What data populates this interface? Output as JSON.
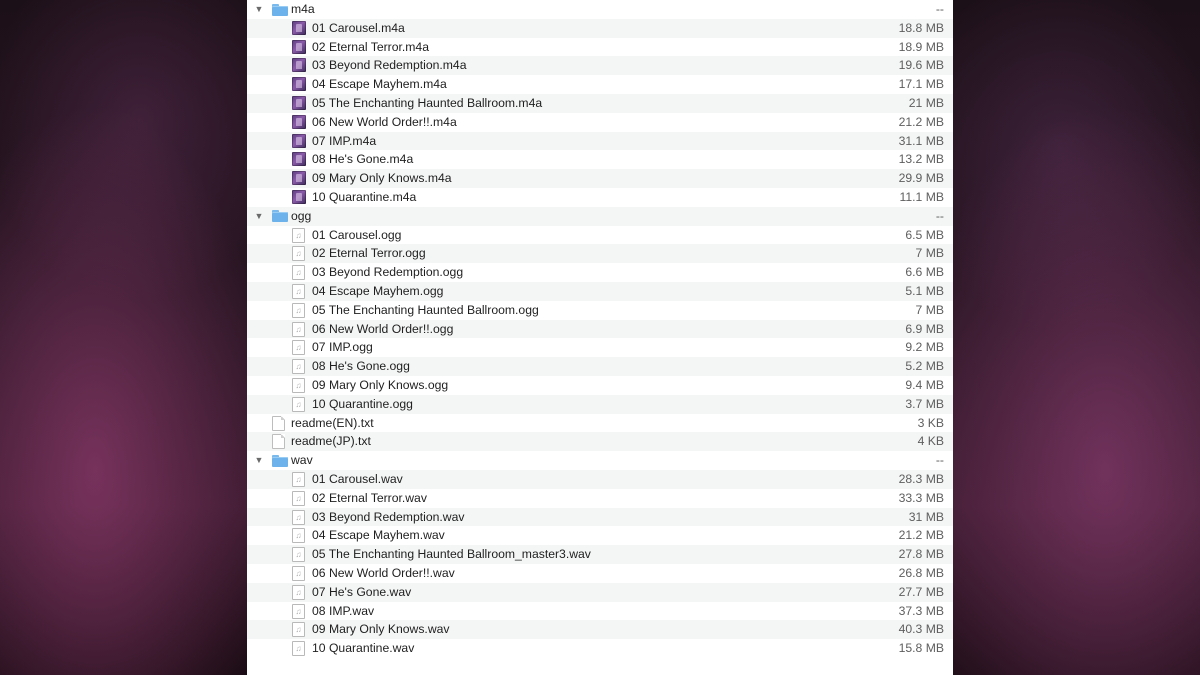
{
  "rows": [
    {
      "type": "folder",
      "name": "m4a",
      "size": "--",
      "expanded": true,
      "icon": "folder-icon"
    },
    {
      "type": "m4a",
      "name": "01 Carousel.m4a",
      "size": "18.8 MB",
      "icon": "album-art-icon"
    },
    {
      "type": "m4a",
      "name": "02 Eternal Terror.m4a",
      "size": "18.9 MB",
      "icon": "album-art-icon"
    },
    {
      "type": "m4a",
      "name": "03 Beyond Redemption.m4a",
      "size": "19.6 MB",
      "icon": "album-art-icon"
    },
    {
      "type": "m4a",
      "name": "04 Escape Mayhem.m4a",
      "size": "17.1 MB",
      "icon": "album-art-icon"
    },
    {
      "type": "m4a",
      "name": "05 The Enchanting Haunted Ballroom.m4a",
      "size": "21 MB",
      "icon": "album-art-icon"
    },
    {
      "type": "m4a",
      "name": "06 New World Order!!.m4a",
      "size": "21.2 MB",
      "icon": "album-art-icon"
    },
    {
      "type": "m4a",
      "name": "07 IMP.m4a",
      "size": "31.1 MB",
      "icon": "album-art-icon"
    },
    {
      "type": "m4a",
      "name": "08 He's Gone.m4a",
      "size": "13.2 MB",
      "icon": "album-art-icon"
    },
    {
      "type": "m4a",
      "name": "09 Mary Only Knows.m4a",
      "size": "29.9 MB",
      "icon": "album-art-icon"
    },
    {
      "type": "m4a",
      "name": "10 Quarantine.m4a",
      "size": "11.1 MB",
      "icon": "album-art-icon"
    },
    {
      "type": "folder",
      "name": "ogg",
      "size": "--",
      "expanded": true,
      "icon": "folder-icon"
    },
    {
      "type": "audio",
      "name": "01 Carousel.ogg",
      "size": "6.5 MB",
      "icon": "audio-file-icon"
    },
    {
      "type": "audio",
      "name": "02 Eternal Terror.ogg",
      "size": "7 MB",
      "icon": "audio-file-icon"
    },
    {
      "type": "audio",
      "name": "03 Beyond Redemption.ogg",
      "size": "6.6 MB",
      "icon": "audio-file-icon"
    },
    {
      "type": "audio",
      "name": "04 Escape Mayhem.ogg",
      "size": "5.1 MB",
      "icon": "audio-file-icon"
    },
    {
      "type": "audio",
      "name": "05 The Enchanting Haunted Ballroom.ogg",
      "size": "7 MB",
      "icon": "audio-file-icon"
    },
    {
      "type": "audio",
      "name": "06 New World Order!!.ogg",
      "size": "6.9 MB",
      "icon": "audio-file-icon"
    },
    {
      "type": "audio",
      "name": "07 IMP.ogg",
      "size": "9.2 MB",
      "icon": "audio-file-icon"
    },
    {
      "type": "audio",
      "name": "08 He's Gone.ogg",
      "size": "5.2 MB",
      "icon": "audio-file-icon"
    },
    {
      "type": "audio",
      "name": "09 Mary Only Knows.ogg",
      "size": "9.4 MB",
      "icon": "audio-file-icon"
    },
    {
      "type": "audio",
      "name": "10 Quarantine.ogg",
      "size": "3.7 MB",
      "icon": "audio-file-icon"
    },
    {
      "type": "text",
      "name": "readme(EN).txt",
      "size": "3 KB",
      "icon": "text-file-icon"
    },
    {
      "type": "text",
      "name": "readme(JP).txt",
      "size": "4 KB",
      "icon": "text-file-icon"
    },
    {
      "type": "folder",
      "name": "wav",
      "size": "--",
      "expanded": true,
      "icon": "folder-icon"
    },
    {
      "type": "audio",
      "name": "01 Carousel.wav",
      "size": "28.3 MB",
      "icon": "audio-file-icon"
    },
    {
      "type": "audio",
      "name": "02 Eternal Terror.wav",
      "size": "33.3 MB",
      "icon": "audio-file-icon"
    },
    {
      "type": "audio",
      "name": "03 Beyond Redemption.wav",
      "size": "31 MB",
      "icon": "audio-file-icon"
    },
    {
      "type": "audio",
      "name": "04 Escape Mayhem.wav",
      "size": "21.2 MB",
      "icon": "audio-file-icon"
    },
    {
      "type": "audio",
      "name": "05 The Enchanting Haunted Ballroom_master3.wav",
      "size": "27.8 MB",
      "icon": "audio-file-icon"
    },
    {
      "type": "audio",
      "name": "06 New World Order!!.wav",
      "size": "26.8 MB",
      "icon": "audio-file-icon"
    },
    {
      "type": "audio",
      "name": "07 He's Gone.wav",
      "size": "27.7 MB",
      "icon": "audio-file-icon"
    },
    {
      "type": "audio",
      "name": "08 IMP.wav",
      "size": "37.3 MB",
      "icon": "audio-file-icon"
    },
    {
      "type": "audio",
      "name": "09 Mary Only Knows.wav",
      "size": "40.3 MB",
      "icon": "audio-file-icon"
    },
    {
      "type": "audio",
      "name": "10 Quarantine.wav",
      "size": "15.8 MB",
      "icon": "audio-file-icon"
    }
  ],
  "colors": {
    "folder": "#6db2ea",
    "zebra_row": "#f4f5f5",
    "size_text": "#5e5e5e"
  }
}
